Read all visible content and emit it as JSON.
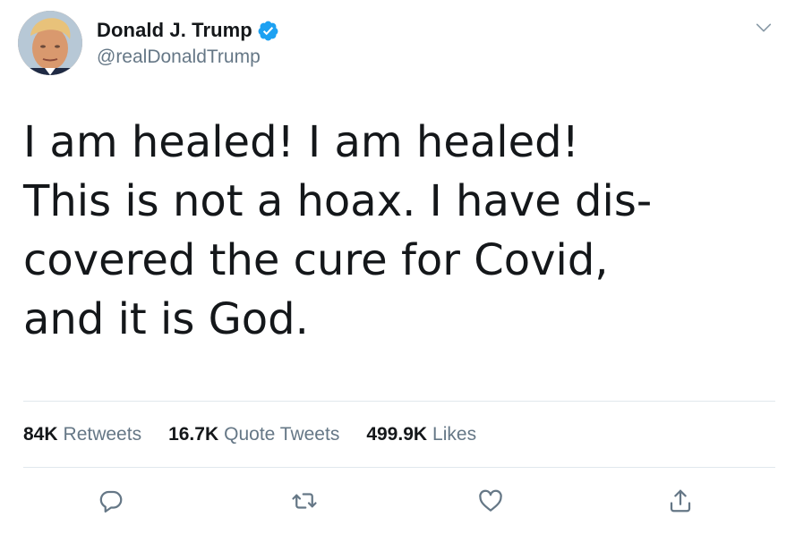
{
  "user": {
    "display_name": "Donald J. Trump",
    "handle": "@realDonaldTrump",
    "verified": true,
    "verified_color": "#1da1f2"
  },
  "tweet": {
    "text": "I am healed! I am healed!\nThis is not a hoax. I have dis-\ncovered the cure for Covid,\nand it is God."
  },
  "stats": [
    {
      "count": "84K",
      "label": "Retweets"
    },
    {
      "count": "16.7K",
      "label": "Quote Tweets"
    },
    {
      "count": "499.9K",
      "label": "Likes"
    }
  ],
  "icons": {
    "avatar": "profile-photo",
    "verified": "verified-badge-icon",
    "menu": "chevron-down-icon",
    "reply": "reply-icon",
    "retweet": "retweet-icon",
    "like": "heart-icon",
    "share": "share-icon"
  },
  "colors": {
    "text": "#14171a",
    "secondary": "#657786",
    "divider": "#e1e8ed",
    "icon": "#657786"
  }
}
